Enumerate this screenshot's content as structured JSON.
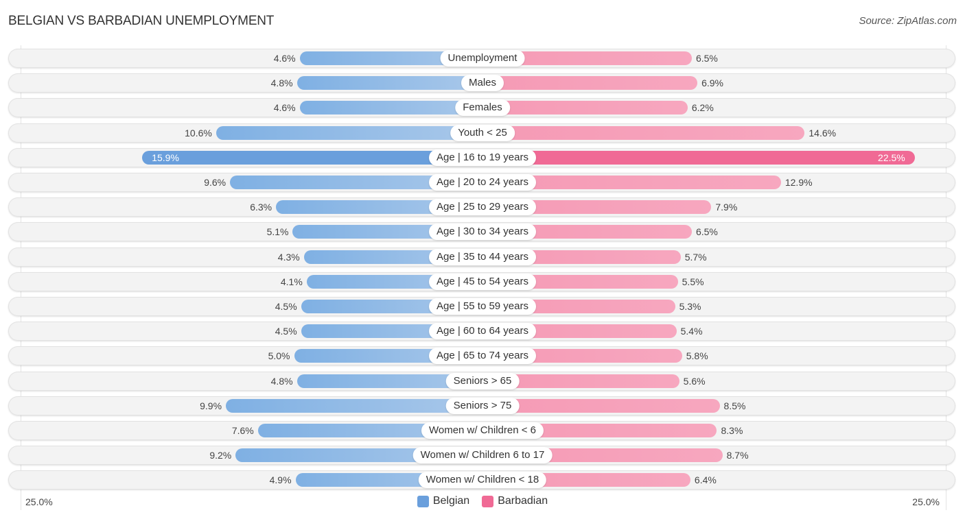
{
  "header": {
    "title": "BELGIAN VS BARBADIAN UNEMPLOYMENT",
    "source": "Source: ZipAtlas.com"
  },
  "chart_data": {
    "type": "bar",
    "orientation": "horizontal-diverging",
    "title": "BELGIAN VS BARBADIAN UNEMPLOYMENT",
    "xlabel": "",
    "ylabel": "",
    "xlim": [
      0,
      25.0
    ],
    "axis_labels": {
      "left": "25.0%",
      "right": "25.0%"
    },
    "legend": {
      "position": "bottom-center",
      "entries": [
        "Belgian",
        "Barbadian"
      ]
    },
    "colors": {
      "Belgian": "#6a9fdc",
      "Barbadian": "#f06a95"
    },
    "categories": [
      "Unemployment",
      "Males",
      "Females",
      "Youth < 25",
      "Age | 16 to 19 years",
      "Age | 20 to 24 years",
      "Age | 25 to 29 years",
      "Age | 30 to 34 years",
      "Age | 35 to 44 years",
      "Age | 45 to 54 years",
      "Age | 55 to 59 years",
      "Age | 60 to 64 years",
      "Age | 65 to 74 years",
      "Seniors > 65",
      "Seniors > 75",
      "Women w/ Children < 6",
      "Women w/ Children 6 to 17",
      "Women w/ Children < 18"
    ],
    "series": [
      {
        "name": "Belgian",
        "side": "left",
        "values": [
          4.6,
          4.8,
          4.6,
          10.6,
          15.9,
          9.6,
          6.3,
          5.1,
          4.3,
          4.1,
          4.5,
          4.5,
          5.0,
          4.8,
          9.9,
          7.6,
          9.2,
          4.9
        ],
        "labels": [
          "4.6%",
          "4.8%",
          "4.6%",
          "10.6%",
          "15.9%",
          "9.6%",
          "6.3%",
          "5.1%",
          "4.3%",
          "4.1%",
          "4.5%",
          "4.5%",
          "5.0%",
          "4.8%",
          "9.9%",
          "7.6%",
          "9.2%",
          "4.9%"
        ]
      },
      {
        "name": "Barbadian",
        "side": "right",
        "values": [
          6.5,
          6.9,
          6.2,
          14.6,
          22.5,
          12.9,
          7.9,
          6.5,
          5.7,
          5.5,
          5.3,
          5.4,
          5.8,
          5.6,
          8.5,
          8.3,
          8.7,
          6.4
        ],
        "labels": [
          "6.5%",
          "6.9%",
          "6.2%",
          "14.6%",
          "22.5%",
          "12.9%",
          "7.9%",
          "6.5%",
          "5.7%",
          "5.5%",
          "5.3%",
          "5.4%",
          "5.8%",
          "5.6%",
          "8.5%",
          "8.3%",
          "8.7%",
          "6.4%"
        ]
      }
    ],
    "highlighted_category": "Age | 16 to 19 years"
  }
}
